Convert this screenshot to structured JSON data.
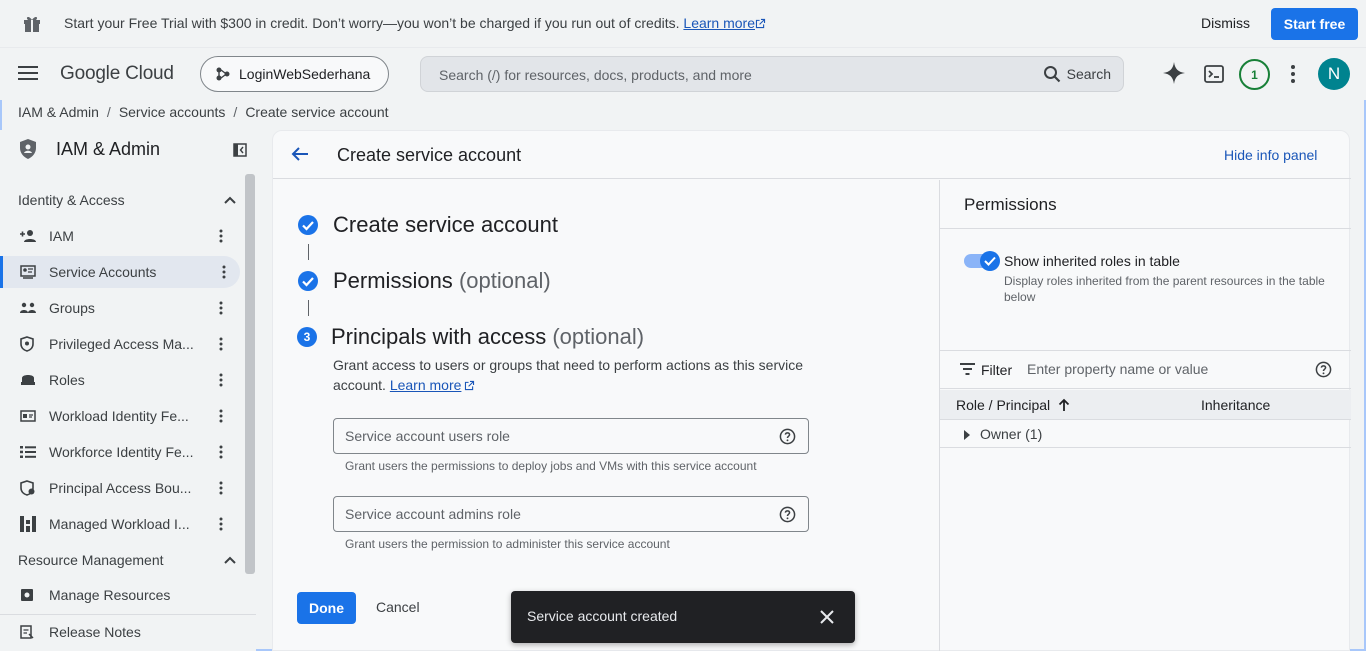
{
  "promo": {
    "text": "Start your Free Trial with $300 in credit. Don’t worry—you won’t be charged if you run out of credits.",
    "learn_more": "Learn more",
    "dismiss": "Dismiss",
    "start_free": "Start free"
  },
  "header": {
    "logo": "Google Cloud",
    "project": "LoginWebSederhana",
    "search_placeholder": "Search (/) for resources, docs, products, and more",
    "search_button": "Search",
    "notifications_count": "1",
    "avatar_letter": "N"
  },
  "breadcrumb": [
    "IAM & Admin",
    "Service accounts",
    "Create service account"
  ],
  "sidebar": {
    "title": "IAM & Admin",
    "section_identity": "Identity & Access",
    "items": [
      {
        "label": "IAM",
        "icon": "person-add-icon"
      },
      {
        "label": "Service Accounts",
        "icon": "service-account-icon"
      },
      {
        "label": "Groups",
        "icon": "groups-icon"
      },
      {
        "label": "Privileged Access Ma...",
        "icon": "shield-icon"
      },
      {
        "label": "Roles",
        "icon": "roles-icon"
      },
      {
        "label": "Workload Identity Fe...",
        "icon": "workload-identity-icon"
      },
      {
        "label": "Workforce Identity Fe...",
        "icon": "list-icon"
      },
      {
        "label": "Principal Access Bou...",
        "icon": "shield-settings-icon"
      },
      {
        "label": "Managed Workload I...",
        "icon": "managed-workload-icon"
      }
    ],
    "section_resource": "Resource Management",
    "manage_resources": "Manage Resources",
    "release_notes": "Release Notes"
  },
  "main": {
    "title": "Create service account",
    "hide_info": "Hide info panel",
    "step1": "Create service account",
    "step2": "Permissions",
    "step2_opt": "(optional)",
    "step3_num": "3",
    "step3": "Principals with access",
    "step3_opt": "(optional)",
    "description": "Grant access to users or groups that need to perform actions as this service account.",
    "learn_more": "Learn more",
    "users_role_placeholder": "Service account users role",
    "users_role_hint": "Grant users the permissions to deploy jobs and VMs with this service account",
    "admins_role_placeholder": "Service account admins role",
    "admins_role_hint": "Grant users the permission to administer this service account",
    "done": "Done",
    "cancel": "Cancel"
  },
  "info_panel": {
    "title": "Permissions",
    "toggle_label": "Show inherited roles in table",
    "toggle_desc": "Display roles inherited from the parent resources in the table below",
    "filter_label": "Filter",
    "filter_placeholder": "Enter property name or value",
    "col_role": "Role / Principal",
    "col_inheritance": "Inheritance",
    "row_owner": "Owner (1)"
  },
  "snackbar": {
    "text": "Service account created"
  },
  "colors": {
    "accent": "#1a73e8",
    "link": "#1a56b8",
    "success": "#188038",
    "avatar": "#00838f"
  }
}
